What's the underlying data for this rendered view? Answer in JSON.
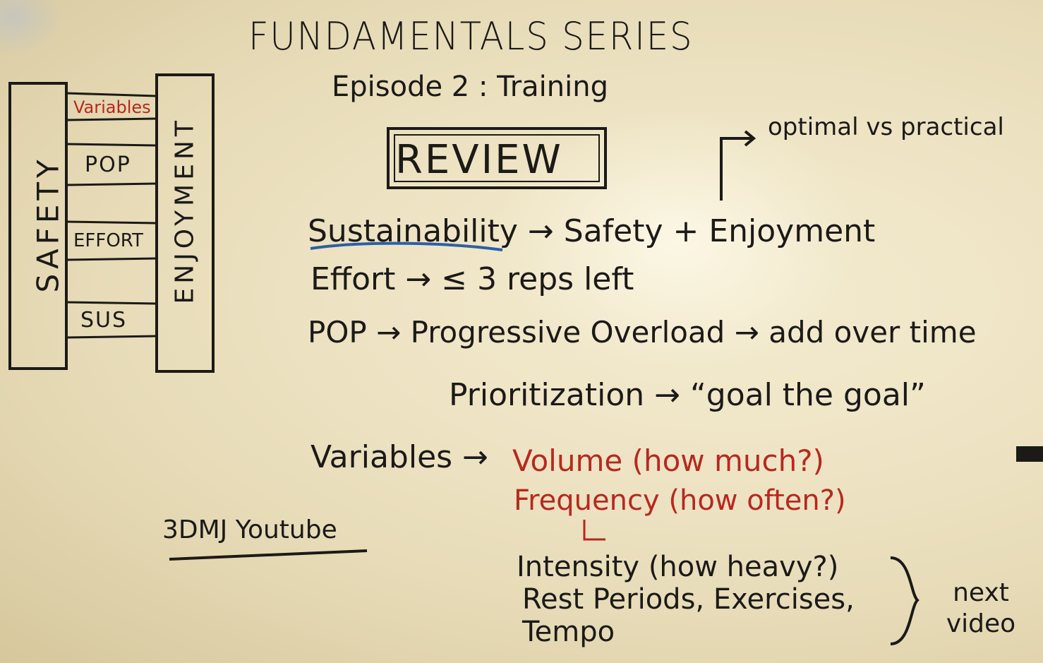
{
  "whiteboard": {
    "title": "FUNDAMENTALS SERIES",
    "subtitle": "Episode 2 : Training",
    "review": "REVIEW",
    "note_top_right": "optimal vs practical",
    "ladder": {
      "left_rail": "SAFETY",
      "right_rail": "ENJOYMENT",
      "rungs": [
        "Variables",
        "POP",
        "EFFORT",
        "SUS"
      ]
    },
    "lines": [
      "Sustainability → Safety + Enjoyment",
      "Effort → ≤ 3 reps left",
      "POP → Progressive Overload → add over time",
      "Prioritization → “goal the goal”",
      "Variables →"
    ],
    "variables_red": [
      "Volume (how much?)",
      "Frequency (how often?)"
    ],
    "next_items": [
      "Intensity (how heavy?)",
      "Rest Periods, Exercises,",
      "Tempo"
    ],
    "next_label": "next video",
    "credit": "3DMJ Youtube",
    "colors": {
      "ink": "#1b1a17",
      "red_marker": "#b8281f",
      "blue_marker": "#2a5fa8",
      "board": "#efe5c6"
    }
  }
}
